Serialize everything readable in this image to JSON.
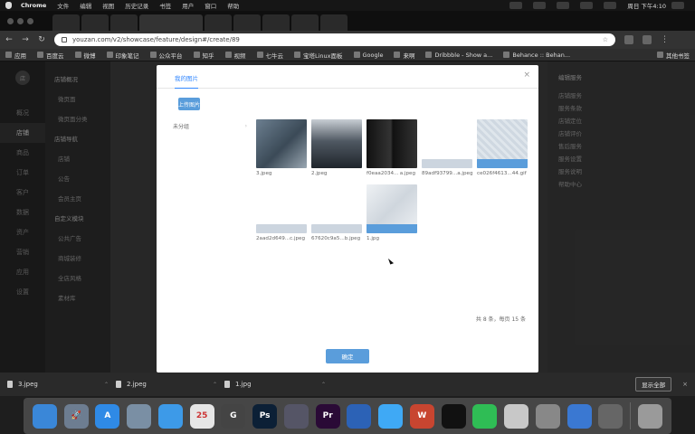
{
  "menubar": {
    "app": "Chrome",
    "items": [
      "文件",
      "编辑",
      "视图",
      "历史记录",
      "书签",
      "用户",
      "窗口",
      "帮助"
    ],
    "clock": "周日 下午4:10"
  },
  "address": {
    "url": "youzan.com/v2/showcase/feature/design#/create/89"
  },
  "bookmarks": {
    "items": [
      "应用",
      "百度云",
      "微博",
      "印象笔记",
      "公众平台",
      "知乎",
      "视频",
      "七牛云",
      "宝塔Linux面板",
      "Google",
      "来啊",
      "Dribbble - Show a...",
      "Behance :: Behan..."
    ],
    "other": "其他书签"
  },
  "sidebar": {
    "rail_items": [
      "概况",
      "店铺",
      "商品",
      "订单",
      "客户",
      "数据",
      "资产",
      "营销",
      "应用",
      "设置"
    ],
    "sub_items": [
      "店铺概况",
      "微页面",
      "微页面分类",
      "店铺导航",
      "店铺",
      "公告",
      "会员主页",
      "自定义模块",
      "公共广告",
      "商城装修",
      "全店风格",
      "素材库"
    ]
  },
  "rightpanel": {
    "title": "编辑服务",
    "lines": [
      "店铺服务",
      "服务条款",
      "店铺定位",
      "店铺评价",
      "售后服务",
      "服务设置",
      "服务说明",
      "帮助中心"
    ]
  },
  "modal": {
    "tab": "我的图片",
    "close": "×",
    "upload_button": "上传图片",
    "groups": [
      {
        "label": "未分组"
      }
    ],
    "images": [
      {
        "name": "3.jpeg",
        "size": "",
        "color": "#566a7a",
        "style": "photo1",
        "col": 0,
        "row": 0
      },
      {
        "name": "2.jpeg",
        "size": "",
        "color": "#3e4650",
        "style": "photo2",
        "col": 1,
        "row": 0
      },
      {
        "name": "f0eaa2034...",
        "size": "a.jpeg",
        "color": "#222",
        "style": "books",
        "col": 2,
        "row": 0
      },
      {
        "name": "89adf93799...",
        "size": "a.jpeg",
        "color": "#ccd5df",
        "style": "small",
        "col": 3,
        "row": 0
      },
      {
        "name": "ce026f4613...",
        "size": "44.gif",
        "color": "#ccd5df",
        "style": "pattern",
        "col": 4,
        "row": 0
      },
      {
        "name": "2aad2d649...",
        "size": "c.jpeg",
        "color": "#ccd5df",
        "style": "small",
        "col": 0,
        "row": 1
      },
      {
        "name": "67620c9a5...",
        "size": "b.jpeg",
        "color": "#ccd5df",
        "style": "small",
        "col": 1,
        "row": 1
      },
      {
        "name": "1.jpg",
        "size": "",
        "color": "#e9ecef",
        "style": "selected",
        "col": 2,
        "row": 1
      }
    ],
    "pager": "共 8 条，每页 15 条",
    "confirm": "确定"
  },
  "downloads": {
    "items": [
      "3.jpeg",
      "2.jpeg",
      "1.jpg"
    ],
    "show_all": "显示全部",
    "close": "×"
  },
  "dock": {
    "apps": [
      {
        "name": "finder",
        "color": "#3a87d8",
        "glyph": ""
      },
      {
        "name": "launchpad",
        "color": "#6d7d91",
        "glyph": "🚀"
      },
      {
        "name": "app-store",
        "color": "#2f8ae6",
        "glyph": "A"
      },
      {
        "name": "preview",
        "color": "#7a8fa4",
        "glyph": ""
      },
      {
        "name": "safari",
        "color": "#3d9ae8",
        "glyph": ""
      },
      {
        "name": "calendar",
        "color": "#e6e6e6",
        "glyph": "25"
      },
      {
        "name": "chrome",
        "color": "#444",
        "glyph": "G"
      },
      {
        "name": "photoshop",
        "color": "#0c2036",
        "glyph": "Ps"
      },
      {
        "name": "compressor",
        "color": "#556",
        "glyph": ""
      },
      {
        "name": "premiere",
        "color": "#2a0a36",
        "glyph": "Pr"
      },
      {
        "name": "keynote",
        "color": "#2c62b6",
        "glyph": ""
      },
      {
        "name": "qq-browser",
        "color": "#3fa9f5",
        "glyph": ""
      },
      {
        "name": "wps",
        "color": "#c84530",
        "glyph": "W"
      },
      {
        "name": "qq",
        "color": "#111",
        "glyph": ""
      },
      {
        "name": "wechat",
        "color": "#2fbd55",
        "glyph": ""
      },
      {
        "name": "notes",
        "color": "#c8c8c8",
        "glyph": ""
      },
      {
        "name": "calculator",
        "color": "#888",
        "glyph": ""
      },
      {
        "name": "baidu-netdisk",
        "color": "#3a78d2",
        "glyph": ""
      },
      {
        "name": "sync",
        "color": "#666",
        "glyph": ""
      },
      {
        "name": "trash",
        "color": "#9a9a9a",
        "glyph": ""
      }
    ]
  },
  "colors": {
    "accent": "#5a9ddb",
    "tab_underline": "#3388ff"
  }
}
